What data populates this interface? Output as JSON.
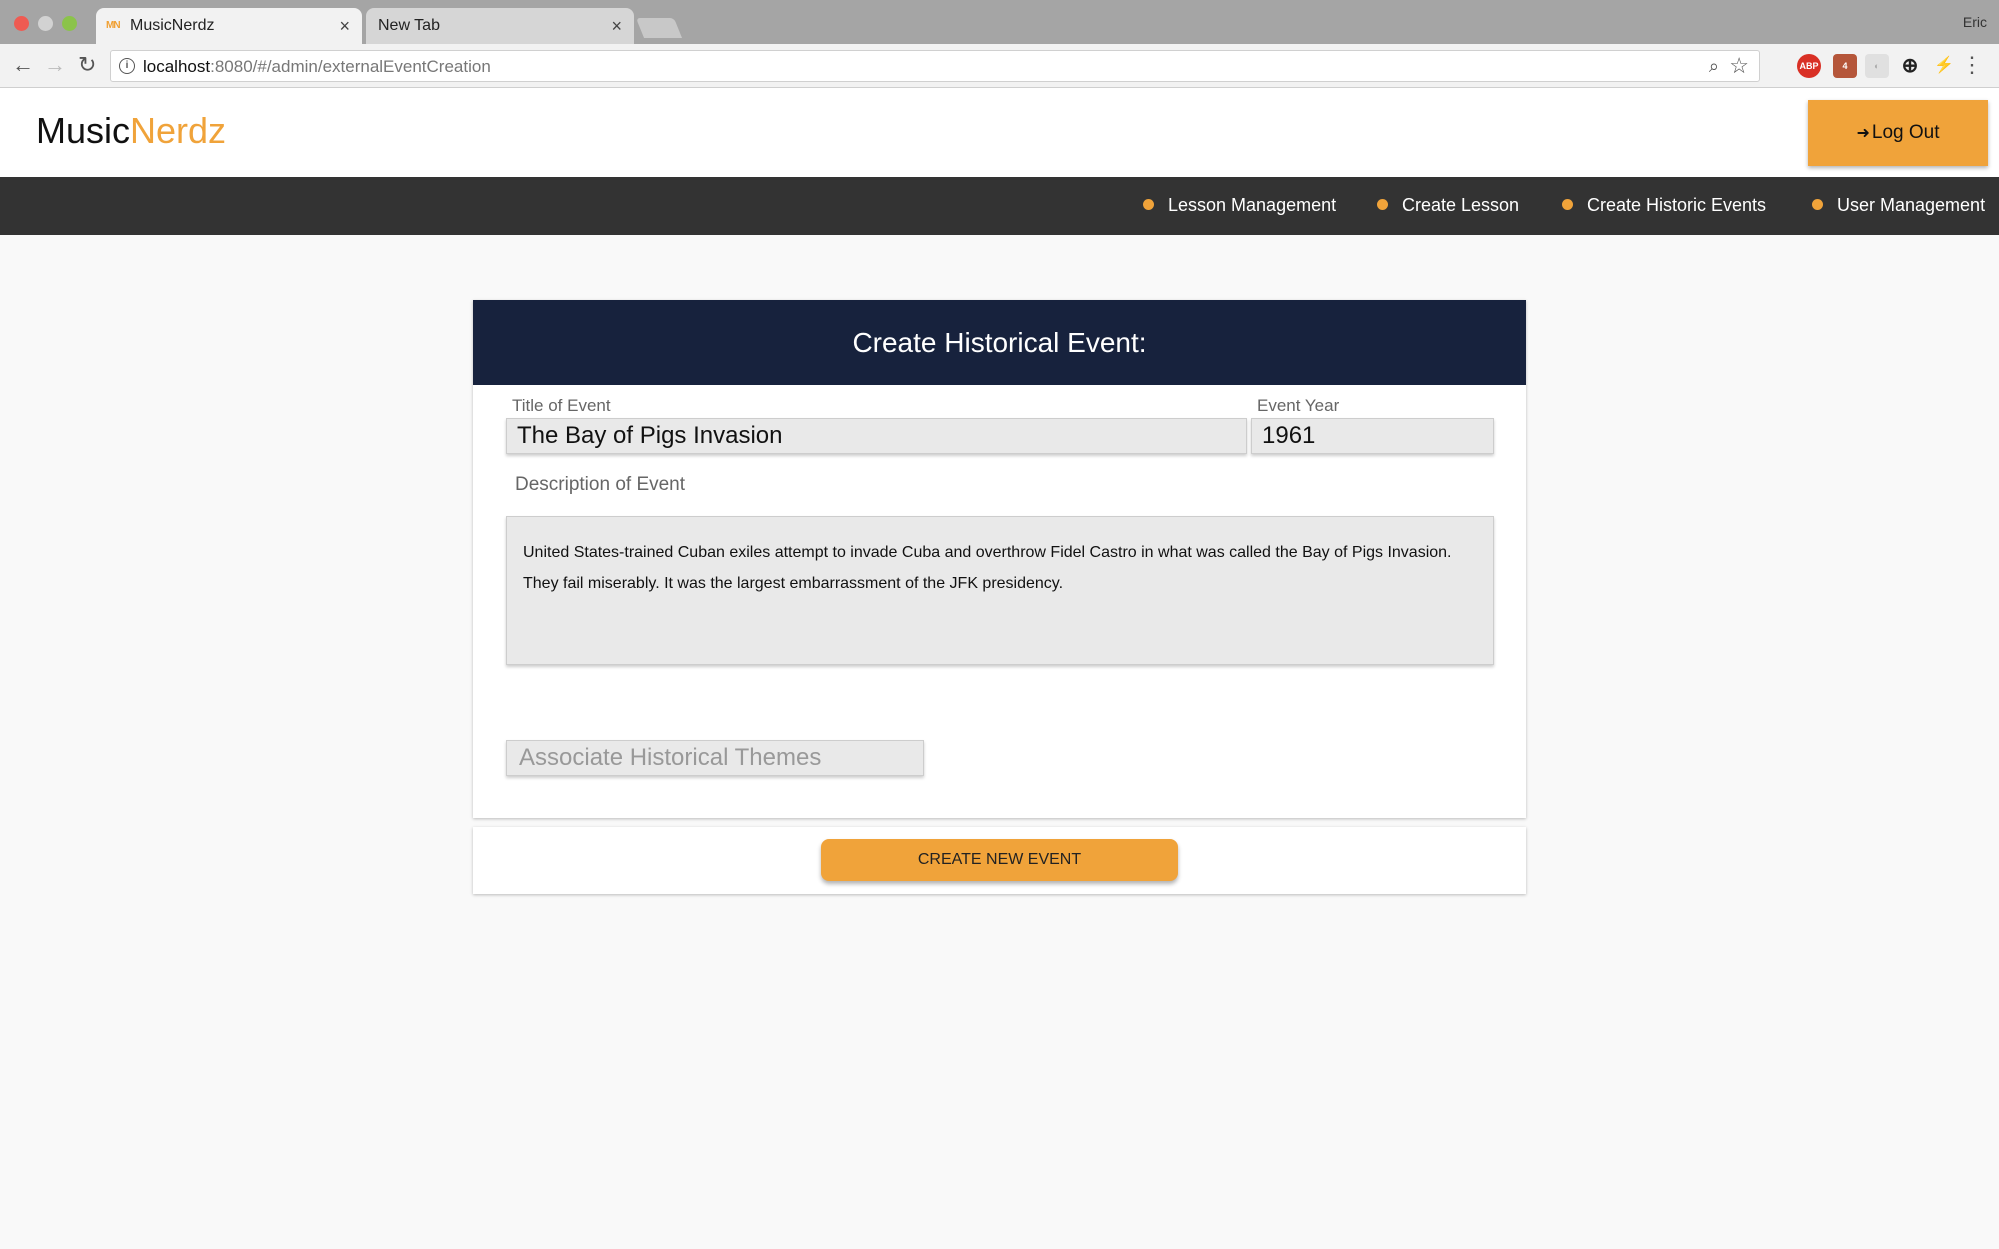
{
  "browser": {
    "tabs": [
      {
        "label": "MusicNerdz",
        "favicon": "MN"
      },
      {
        "label": "New Tab"
      }
    ],
    "profile": "Eric",
    "url_host": "localhost",
    "url_path": ":8080/#/admin/externalEventCreation"
  },
  "header": {
    "logo_part1": "Music",
    "logo_part2": "Nerdz",
    "logout_label": "Log Out",
    "brand_color": "#f0a33a"
  },
  "nav": {
    "items": [
      "Lesson Management",
      "Create Lesson",
      "Create Historic Events",
      "User Management"
    ]
  },
  "form": {
    "heading": "Create Historical Event:",
    "title_label": "Title of Event",
    "title_value": "The Bay of Pigs Invasion",
    "year_label": "Event Year",
    "year_value": "1961",
    "description_label": "Description of Event",
    "description_value": "United States-trained Cuban exiles attempt to invade Cuba and overthrow Fidel Castro in what was called the Bay of Pigs Invasion. They fail miserably. It was the largest embarrassment of the JFK presidency.",
    "themes_placeholder": "Associate Historical Themes",
    "submit_label": "CREATE NEW EVENT",
    "header_color": "#17223d"
  }
}
